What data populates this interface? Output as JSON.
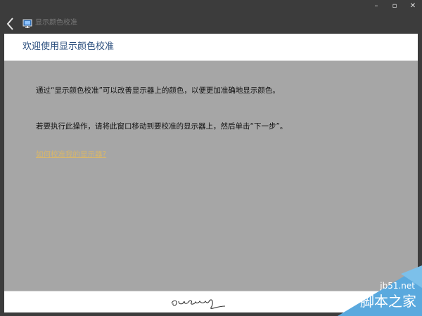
{
  "window": {
    "minimize": "–",
    "maximize": "▫",
    "close": "✕"
  },
  "toolbar": {
    "title": "显示颜色校准"
  },
  "header": {
    "title": "欢迎使用显示颜色校准"
  },
  "body": {
    "paragraph1": "通过“显示颜色校准”可以改善显示器上的颜色，以便更加准确地显示颜色。",
    "paragraph2": "若要执行此操作，请将此窗口移动到要校准的显示器上，然后单击“下一步”。",
    "help_link": "如何校准我的显示器?"
  },
  "footer": {
    "signature_text": "quers"
  },
  "watermark": {
    "url": "jb51.net",
    "name": "脚本之家"
  }
}
